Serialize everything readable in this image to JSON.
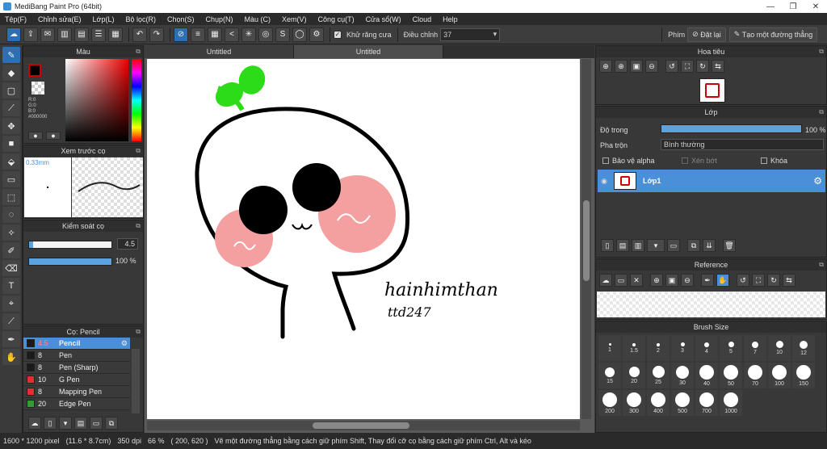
{
  "window": {
    "title": "MediBang Paint Pro (64bit)"
  },
  "menu": [
    "Tệp(F)",
    "Chỉnh sửa(E)",
    "Lớp(L)",
    "Bộ lọc(R)",
    "Chọn(S)",
    "Chụp(N)",
    "Màu (C)",
    "Xem(V)",
    "Công cụ(T)",
    "Cửa sổ(W)",
    "Cloud",
    "Help"
  ],
  "toolbar": {
    "antialias_label": "Khử răng cưa",
    "correction_label": "Điều chỉnh",
    "correction_value": "37",
    "key_label": "Phím",
    "reset_label": "Đặt lại",
    "line_label": "Tạo một đường thẳng"
  },
  "color_panel": {
    "title": "Màu",
    "r": "R:0",
    "g": "G:0",
    "b": "B:0",
    "hex": "#000000"
  },
  "brush_preview": {
    "title": "Xem trước cọ",
    "size": "0.33mm"
  },
  "brush_control": {
    "title": "Kiểm soát cọ",
    "size_value": "4.5",
    "opacity_value": "100 %",
    "size_fraction": 0.05,
    "opacity_fraction": 1.0
  },
  "brush_list": {
    "title": "Cọ: Pencil",
    "items": [
      {
        "size": "4.5",
        "name": "Pencil",
        "color": "#1a1a1a",
        "selected": true
      },
      {
        "size": "8",
        "name": "Pen",
        "color": "#1a1a1a"
      },
      {
        "size": "8",
        "name": "Pen (Sharp)",
        "color": "#1a1a1a"
      },
      {
        "size": "10",
        "name": "G Pen",
        "color": "#e03030"
      },
      {
        "size": "8",
        "name": "Mapping Pen",
        "color": "#e03030"
      },
      {
        "size": "20",
        "name": "Edge Pen",
        "color": "#2fa02f"
      }
    ]
  },
  "tabs": [
    "Untitled",
    "Untitled"
  ],
  "drawing": {
    "signature_line1": "hainhimthan",
    "signature_line2": "ttd247"
  },
  "navigator": {
    "title": "Hoa tiêu"
  },
  "layer_panel": {
    "title": "Lớp",
    "opacity_label": "Độ trong",
    "opacity_value": "100 %",
    "opacity_fraction": 1.0,
    "blend_label": "Pha trộn",
    "blend_value": "Bình thường",
    "protect_alpha": "Bảo vệ alpha",
    "clipping": "Xén bớt",
    "lock": "Khóa",
    "layer_name": "Lớp1"
  },
  "reference": {
    "title": "Reference"
  },
  "brush_size": {
    "title": "Brush Size",
    "sizes": [
      "1",
      "1.5",
      "2",
      "3",
      "4",
      "5",
      "7",
      "10",
      "12",
      "15",
      "20",
      "25",
      "30",
      "40",
      "50",
      "70",
      "100",
      "150",
      "200",
      "300",
      "400",
      "500",
      "700",
      "1000"
    ]
  },
  "status": {
    "size": "1600 * 1200 pixel",
    "physical": "(11.6 * 8.7cm)",
    "dpi": "350 dpi",
    "zoom": "66 %",
    "coords": "( 200, 620 )",
    "hint": "Vẽ một đường thẳng bằng cách giữ phím Shift, Thay đổi cỡ cọ bằng cách giữ phím Ctrl, Alt và kéo"
  },
  "colors": {
    "accent": "#4a90d8",
    "bg": "#3a3a3a",
    "cheek": "#f4a0a0",
    "sprout": "#2ddc18"
  }
}
